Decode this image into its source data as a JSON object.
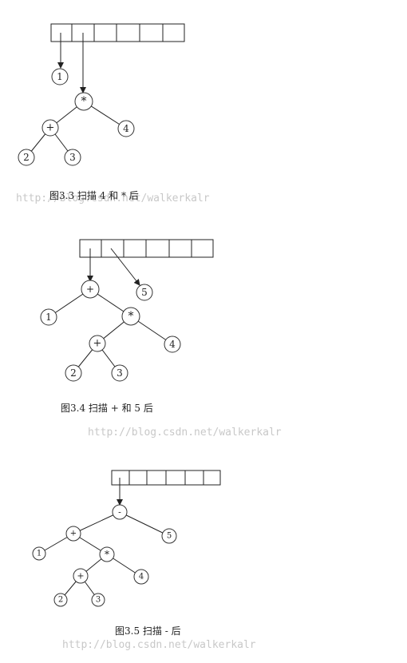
{
  "figures": [
    {
      "caption": "图3.3 扫描 4 和 * 后",
      "watermark": "http://blog.csdn.net/walkerkalr",
      "nodes": [
        "1",
        "*",
        "+",
        "4",
        "2",
        "3"
      ]
    },
    {
      "caption": "图3.4 扫描 + 和 5 后",
      "watermark": "http://blog.csdn.net/walkerkalr",
      "nodes": [
        "+",
        "5",
        "1",
        "*",
        "+",
        "4",
        "2",
        "3"
      ]
    },
    {
      "caption": "图3.5 扫描 - 后",
      "watermark": "http://blog.csdn.net/walkerkalr",
      "nodes": [
        "-",
        "+",
        "5",
        "1",
        "*",
        "+",
        "4",
        "2",
        "3"
      ]
    }
  ]
}
